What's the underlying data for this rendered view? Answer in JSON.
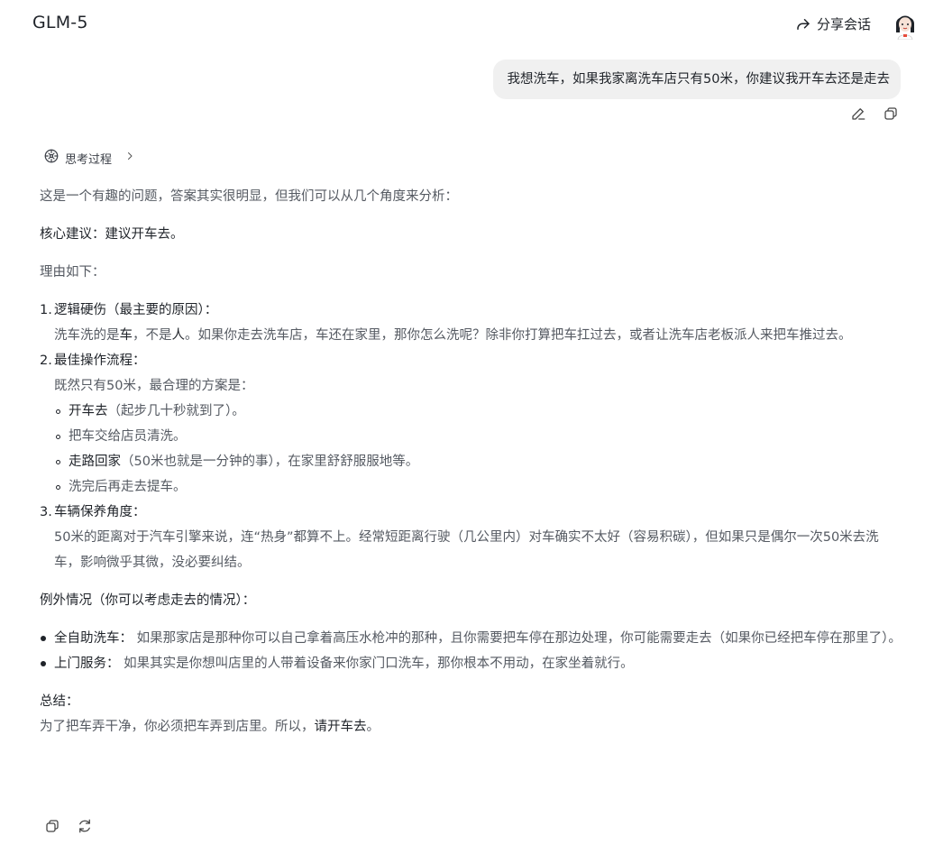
{
  "header": {
    "model_name": "GLM-5",
    "share_label": "分享会话"
  },
  "user_message": {
    "text": "我想洗车，如果我家离洗车店只有50米，你建议我开车去还是走去"
  },
  "thinking": {
    "label": "思考过程"
  },
  "answer": {
    "intro": "这是一个有趣的问题，答案其实很明显，但我们可以从几个角度来分析：",
    "core": "核心建议：建议开车去。",
    "reasons_label": "理由如下：",
    "points": [
      {
        "num": "1.",
        "head": "逻辑硬伤（最主要的原因）：",
        "body_a": "洗车洗的是",
        "body_b": "车",
        "body_c": "，不是",
        "body_d": "人",
        "body_e": "。如果你走去洗车店，车还在家里，那你怎么洗呢？除非你打算把车扛过去，或者让洗车店老板派人来把车推过去。"
      },
      {
        "num": "2.",
        "head": "最佳操作流程：",
        "body": "既然只有50米，最合理的方案是：",
        "steps": [
          {
            "bold": "开车去",
            "rest": "（起步几十秒就到了）。"
          },
          {
            "bold": "",
            "rest": "把车交给店员清洗。"
          },
          {
            "bold": "走路回家",
            "rest": "（50米也就是一分钟的事），在家里舒舒服服地等。"
          },
          {
            "bold": "",
            "rest": "洗完后再走去提车。"
          }
        ]
      },
      {
        "num": "3.",
        "head": "车辆保养角度：",
        "body": "50米的距离对于汽车引擎来说，连“热身”都算不上。经常短距离行驶（几公里内）对车确实不太好（容易积碳），但如果只是偶尔一次50米去洗车，影响微乎其微，没必要纠结。"
      }
    ],
    "exceptions_label": "例外情况（你可以考虑走去的情况）：",
    "exceptions": [
      {
        "bold": "全自助洗车：",
        "rest": " 如果那家店是那种你可以自己拿着高压水枪冲的那种，且你需要把车停在那边处理，你可能需要走去（如果你已经把车停在那里了）。"
      },
      {
        "bold": "上门服务：",
        "rest": " 如果其实是你想叫店里的人带着设备来你家门口洗车，那你根本不用动，在家坐着就行。"
      }
    ],
    "summary_label": "总结：",
    "summary_a": "为了把车弄干净，你必须把车弄到店里。所以，",
    "summary_b": "请开车去",
    "summary_c": "。"
  },
  "icons": {
    "share": "share-arrow-icon",
    "edit": "pencil-icon",
    "copy": "copy-icon",
    "refresh": "refresh-icon",
    "thinking": "brain-icon",
    "chevron": "chevron-right-icon"
  },
  "colors": {
    "text_strong": "#1f2329",
    "text_body": "#555a62",
    "bubble_bg": "#f0f0f0"
  }
}
